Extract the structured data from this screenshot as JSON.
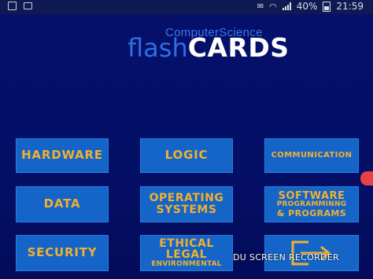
{
  "status_bar": {
    "battery": "40%",
    "time": "21:59",
    "icons": [
      "notification-icon",
      "image-icon",
      "mail-icon",
      "wifi-icon",
      "signal-icon",
      "battery-icon"
    ]
  },
  "logo": {
    "subtitle": "ComputerScience",
    "flash": "flash",
    "cards": "CARDS"
  },
  "tiles": [
    {
      "label": "HARDWARE"
    },
    {
      "label": "LOGIC"
    },
    {
      "label": "COMMUNICATION"
    },
    {
      "label": "DATA"
    },
    {
      "line1": "OPERATING",
      "line2": "SYSTEMS"
    },
    {
      "line1": "SOFTWARE",
      "line2": "PROGRAMMINNG",
      "line3": "& PROGRAMS"
    },
    {
      "label": "SECURITY"
    },
    {
      "line1": "ETHICAL",
      "line2": "LEGAL",
      "line3": "ENVIRONMENTAL"
    },
    {
      "icon": "exit-icon"
    }
  ],
  "watermark": "DU SCREEN RECORDER",
  "colors": {
    "background": "#040f66",
    "tile": "#1565c8",
    "tile_text": "#f0b030",
    "logo_blue": "#2f6fe6",
    "logo_white": "#ffffff",
    "floating_dot": "#e84248"
  }
}
